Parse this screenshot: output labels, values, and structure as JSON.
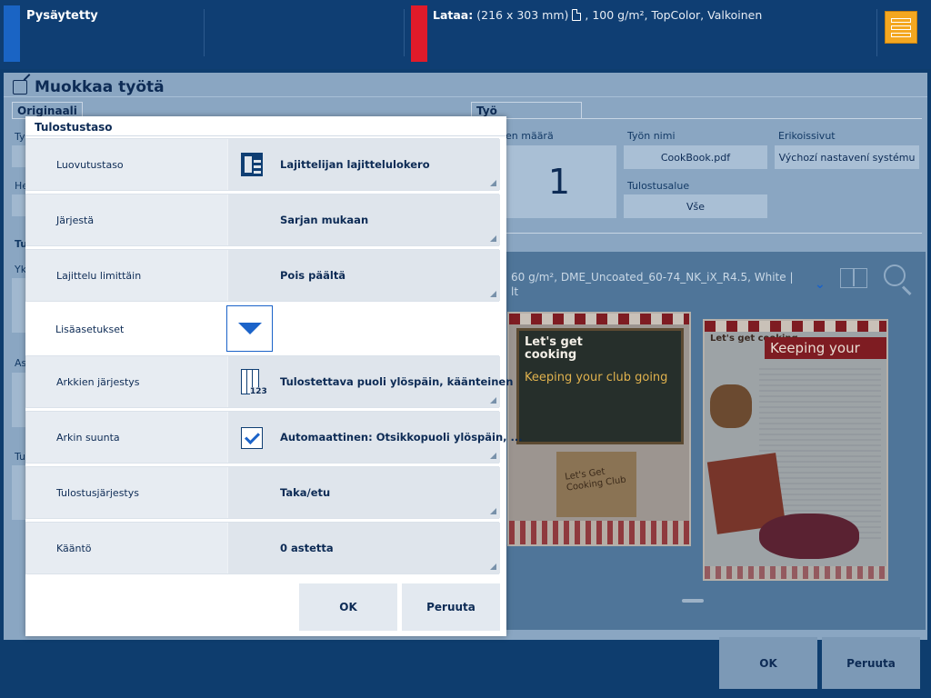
{
  "topbar": {
    "status": "Pysäytetty",
    "load_label": "Lataa:",
    "load_size": "(216 x 303 mm)",
    "load_media": ", 100 g/m², TopColor, Valkoinen",
    "colors": {
      "status": "#1a64c4",
      "load": "#e01b2a",
      "server": "#f4a720"
    }
  },
  "window": {
    "title": "Muokkaa työtä",
    "tabs": {
      "original": "Originaali",
      "work": "Työ"
    },
    "fields": {
      "count_label": "en määrä",
      "count_value": "1",
      "job_name_label": "Työn nimi",
      "job_name_value": "CookBook.pdf",
      "special_pages_label": "Erikoissivut",
      "special_pages_value": "Výchozí nastavení systému",
      "print_area_label": "Tulostusalue",
      "print_area_value": "Vše"
    },
    "left_fragments": [
      "Ty",
      "He",
      "Tu",
      "Yk",
      "As",
      "Tu"
    ],
    "preview": {
      "media_line1": "60 g/m², DME_Uncoated_60-74_NK_iX_R4.5, White |",
      "media_line2": "lt",
      "page1": {
        "heading": "Let's get cooking",
        "slogan": "Keeping your club going",
        "crate_text": "Let's Get Cooking Club"
      },
      "page2": {
        "logo": "Let's get cooking",
        "banner": "Keeping your"
      }
    },
    "buttons": {
      "ok": "OK",
      "cancel": "Peruuta"
    }
  },
  "dialog": {
    "title": "Tulostustaso",
    "rows": [
      {
        "label": "Luovutustaso",
        "value": "Lajittelijan lajittelulokero"
      },
      {
        "label": "Järjestä",
        "value": "Sarjan mukaan"
      },
      {
        "label": "Lajittelu limittäin",
        "value": "Pois päältä"
      },
      {
        "label": "Arkkien järjestys",
        "value": "Tulostettava puoli ylöspäin, käänteinen",
        "icon_text": "123"
      },
      {
        "label": "Arkin suunta",
        "value": "Automaattinen: Otsikkopuoli ylöspäin, ..."
      },
      {
        "label": "Tulostusjärjestys",
        "value": "Taka/etu"
      },
      {
        "label": "Kääntö",
        "value": "0 astetta"
      }
    ],
    "more_label": "Lisäasetukset",
    "buttons": {
      "ok": "OK",
      "cancel": "Peruuta"
    }
  }
}
